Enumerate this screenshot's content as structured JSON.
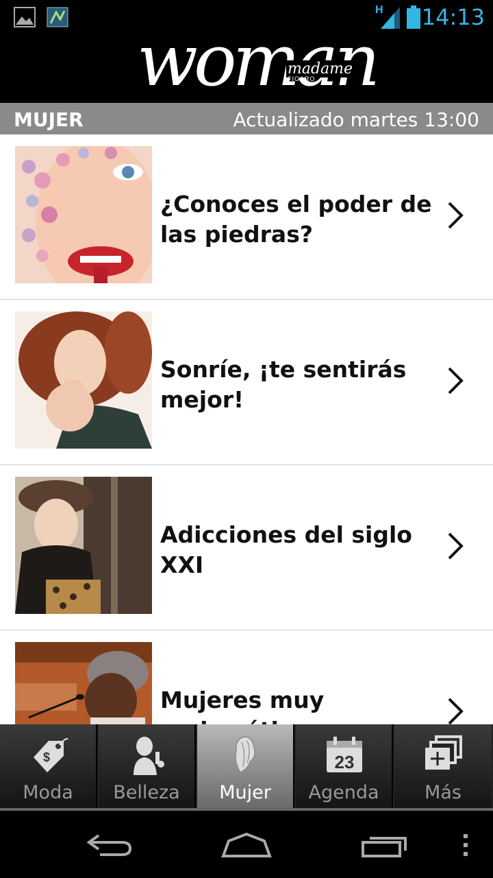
{
  "status_bar": {
    "time": "14:13",
    "network_type": "H",
    "icons": [
      "gallery-icon",
      "app-notification-icon",
      "signal-icon",
      "battery-icon"
    ],
    "accent_color": "#33b5e5"
  },
  "header": {
    "logo_text": "woman",
    "logo_sub": "madame",
    "logo_figaro": "FIGARO"
  },
  "section": {
    "title": "MUJER",
    "updated": "Actualizado martes 13:00"
  },
  "articles": [
    {
      "title": "¿Conoces el poder de las piedras?",
      "icon": "chevron-right-icon"
    },
    {
      "title": "Sonríe, ¡te sentirás mejor!",
      "icon": "chevron-right-icon"
    },
    {
      "title": "Adicciones del siglo XXI",
      "icon": "chevron-right-icon"
    },
    {
      "title": "Mujeres muy carismáticas",
      "icon": "chevron-right-icon"
    }
  ],
  "tabs": [
    {
      "label": "Moda",
      "icon": "price-tag-icon",
      "active": false
    },
    {
      "label": "Belleza",
      "icon": "woman-makeup-icon",
      "active": false
    },
    {
      "label": "Mujer",
      "icon": "woman-hair-icon",
      "active": true
    },
    {
      "label": "Agenda",
      "icon": "calendar-icon",
      "active": false,
      "calendar_day": "23"
    },
    {
      "label": "Más",
      "icon": "add-stack-icon",
      "active": false
    }
  ],
  "nav": {
    "icons": [
      "back-icon",
      "home-icon",
      "recent-apps-icon",
      "overflow-menu-icon"
    ]
  }
}
